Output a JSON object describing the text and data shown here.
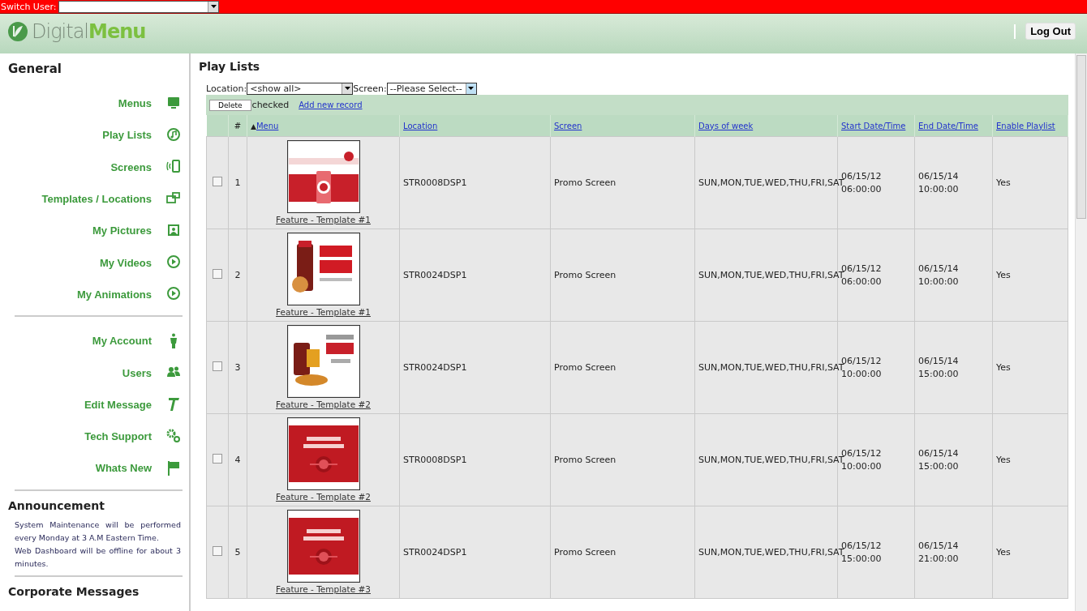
{
  "switch_user": {
    "label": "Switch User:"
  },
  "logo": {
    "prefix": "Digital",
    "suffix": "Menu"
  },
  "logout": "Log Out",
  "sidebar": {
    "title": "General",
    "groups": [
      [
        {
          "label": "Menus"
        },
        {
          "label": "Play Lists"
        },
        {
          "label": "Screens"
        },
        {
          "label": "Templates / Locations"
        },
        {
          "label": "My Pictures"
        },
        {
          "label": "My Videos"
        },
        {
          "label": "My Animations"
        }
      ],
      [
        {
          "label": "My Account"
        },
        {
          "label": "Users"
        },
        {
          "label": "Edit Message"
        },
        {
          "label": "Tech Support"
        },
        {
          "label": "Whats New"
        }
      ]
    ],
    "announcement_title": "Announcement",
    "announcement": [
      "System Maintenance will be performed every Monday at 3 A.M Eastern Time.",
      "Web Dashboard will be offline for about 3 minutes."
    ],
    "corporate_title": "Corporate Messages"
  },
  "page_title": "Play Lists",
  "filters": [
    {
      "label": "Location:",
      "value": "<show all>"
    },
    {
      "label": "Screen:",
      "value": "--Please Select--"
    }
  ],
  "toolbar": {
    "delete": "Delete",
    "checked": "checked",
    "add": "Add new record"
  },
  "columns": [
    "#",
    "Menu",
    "Location",
    "Screen",
    "Days of week",
    "Start Date/Time",
    "End Date/Time",
    "Enable Playlist"
  ],
  "sort_mark": "▲",
  "rows": [
    {
      "checked": false,
      "num": "1",
      "menu": "Feature - Template #1",
      "location": "STR0008DSP1",
      "screen": "Promo Screen",
      "days": "SUN,MON,TUE,WED,THU,FRI,SAT",
      "start": [
        "06/15/12",
        "06:00:00"
      ],
      "end": [
        "06/15/14",
        "10:00:00"
      ],
      "enabled": "Yes"
    },
    {
      "checked": false,
      "num": "2",
      "menu": "Feature - Template #1",
      "location": "STR0024DSP1",
      "screen": "Promo Screen",
      "days": "SUN,MON,TUE,WED,THU,FRI,SAT",
      "start": [
        "06/15/12",
        "06:00:00"
      ],
      "end": [
        "06/15/14",
        "10:00:00"
      ],
      "enabled": "Yes"
    },
    {
      "checked": false,
      "num": "3",
      "menu": "Feature - Template #2",
      "location": "STR0024DSP1",
      "screen": "Promo Screen",
      "days": "SUN,MON,TUE,WED,THU,FRI,SAT",
      "start": [
        "06/15/12",
        "10:00:00"
      ],
      "end": [
        "06/15/14",
        "15:00:00"
      ],
      "enabled": "Yes"
    },
    {
      "checked": false,
      "num": "4",
      "menu": "Feature - Template #2",
      "location": "STR0008DSP1",
      "screen": "Promo Screen",
      "days": "SUN,MON,TUE,WED,THU,FRI,SAT",
      "start": [
        "06/15/12",
        "10:00:00"
      ],
      "end": [
        "06/15/14",
        "15:00:00"
      ],
      "enabled": "Yes"
    },
    {
      "checked": false,
      "num": "5",
      "menu": "Feature - Template #3",
      "location": "STR0024DSP1",
      "screen": "Promo Screen",
      "days": "SUN,MON,TUE,WED,THU,FRI,SAT",
      "start": [
        "06/15/12",
        "15:00:00"
      ],
      "end": [
        "06/15/14",
        "21:00:00"
      ],
      "enabled": "Yes"
    }
  ]
}
